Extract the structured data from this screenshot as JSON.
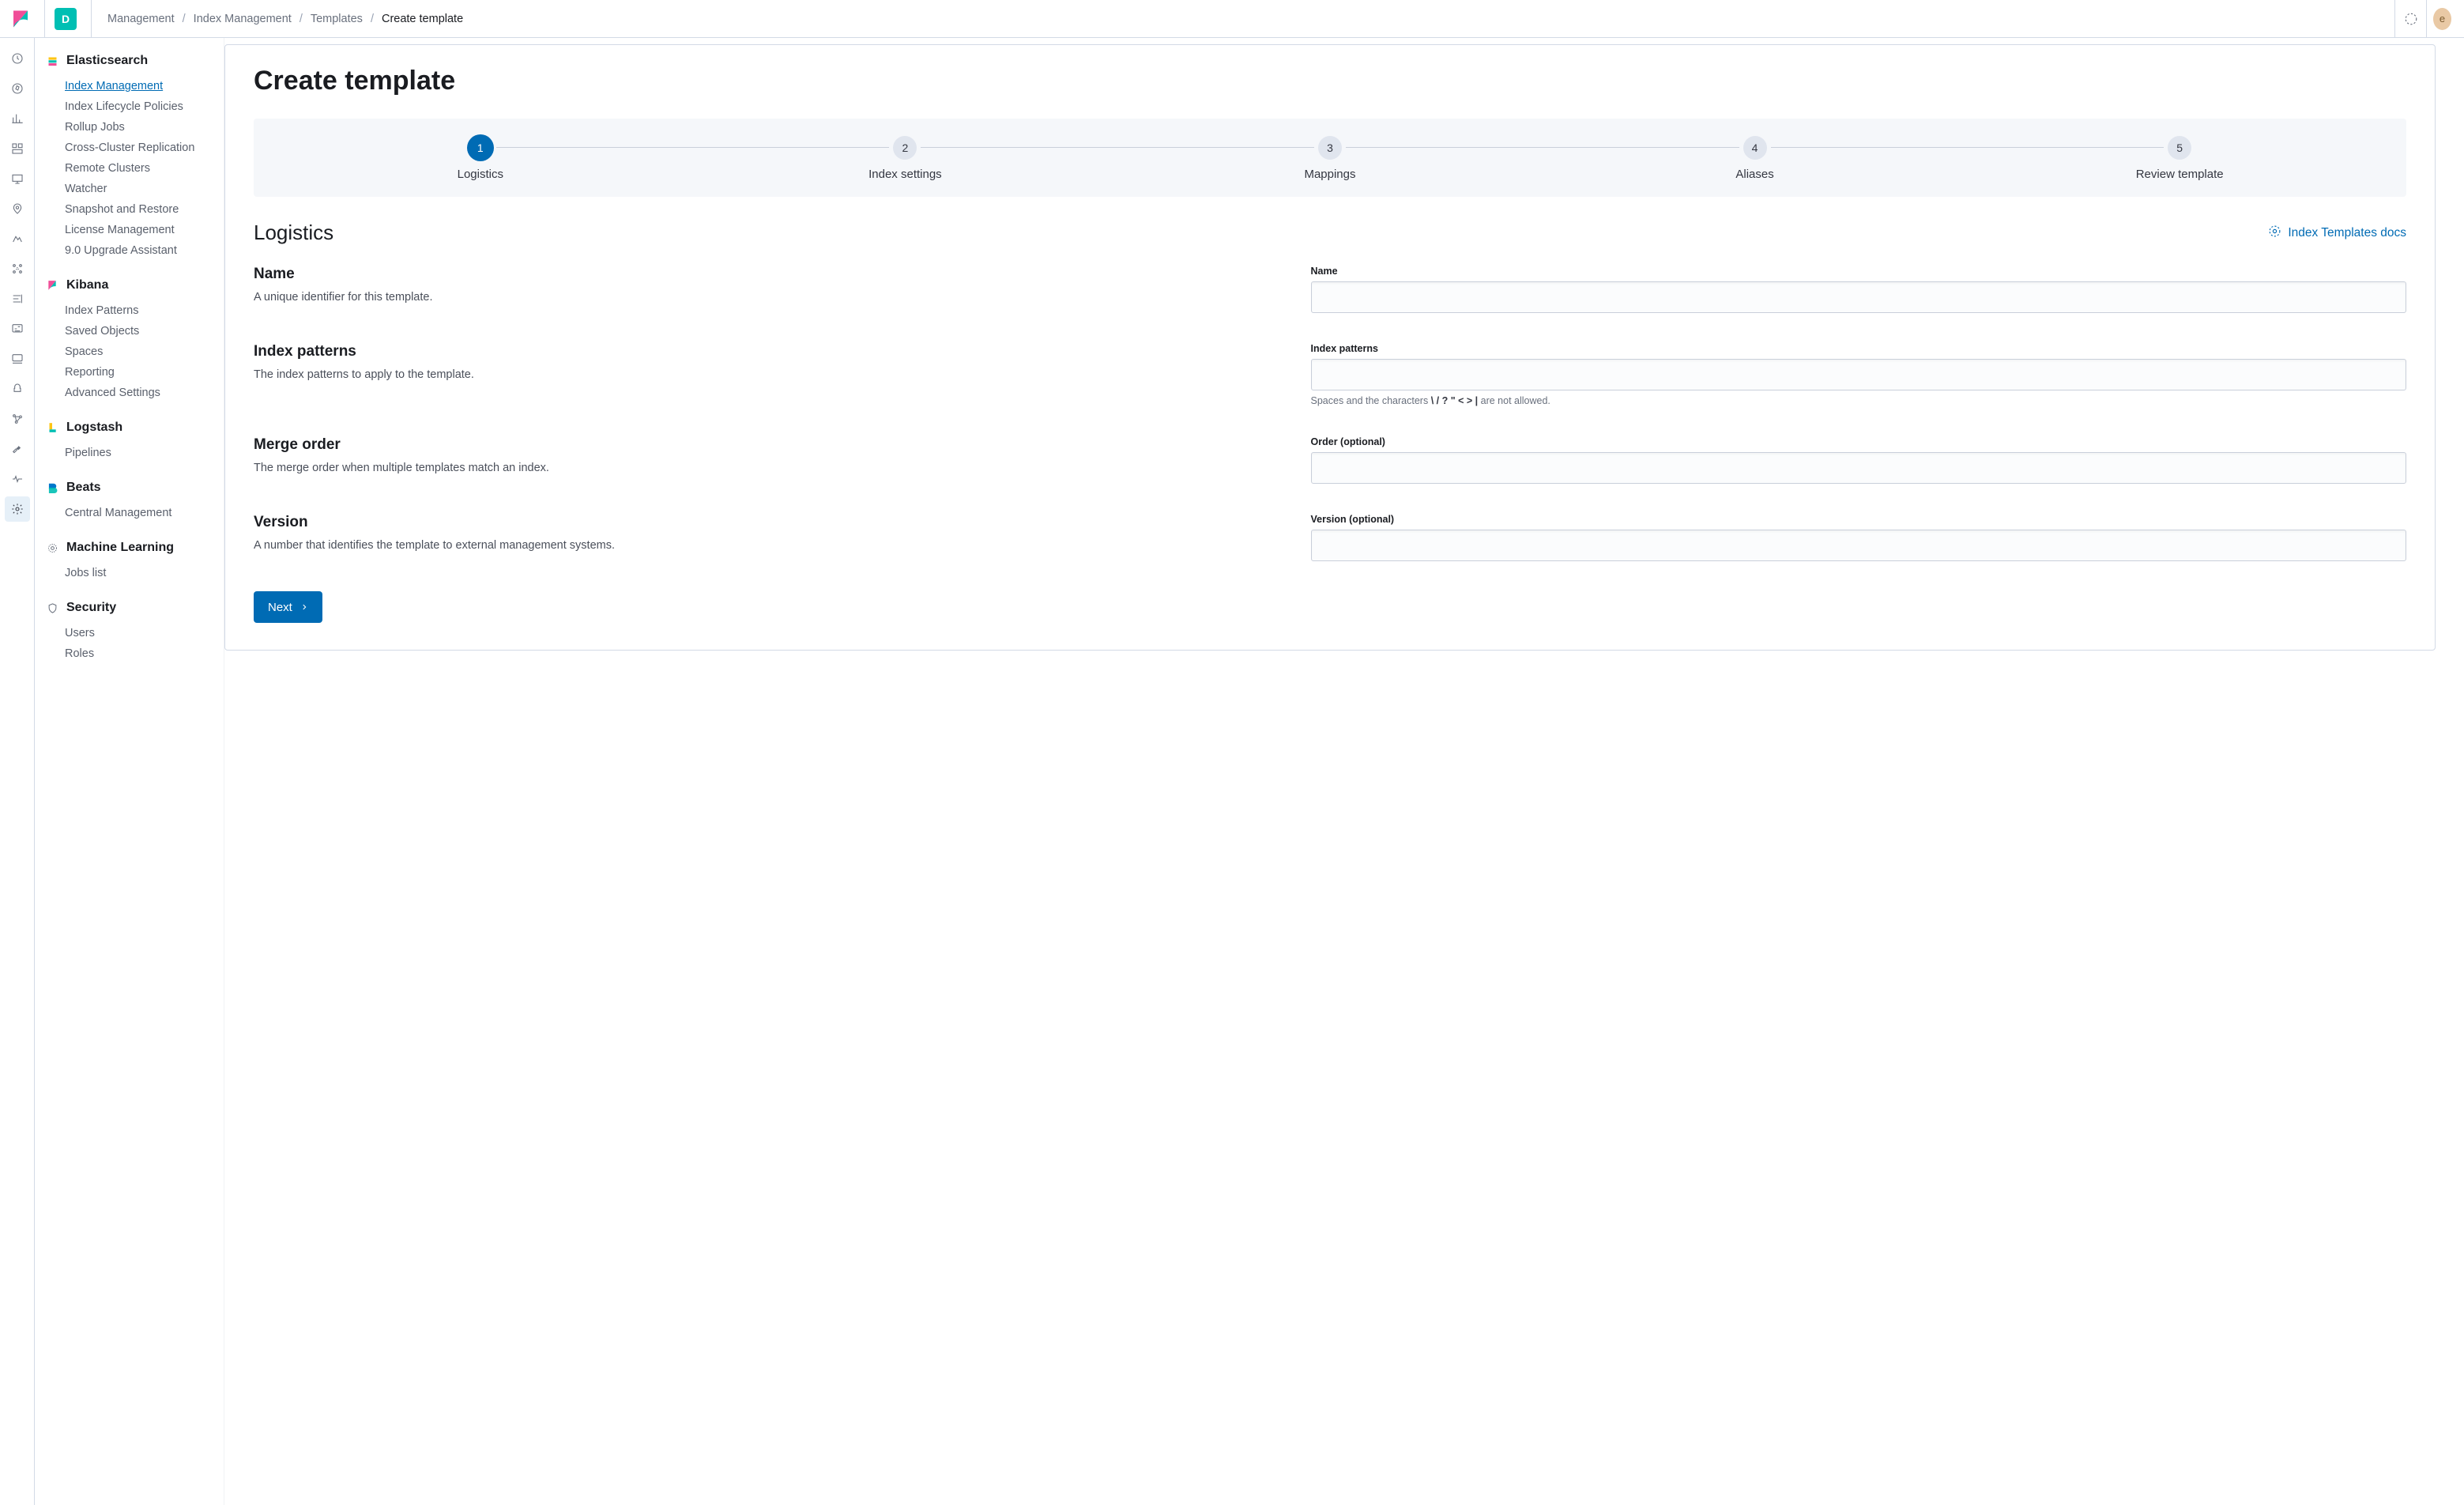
{
  "header": {
    "space_initial": "D",
    "avatar_initial": "e",
    "breadcrumbs": [
      "Management",
      "Index Management",
      "Templates",
      "Create template"
    ]
  },
  "sidebar": {
    "sections": [
      {
        "title": "Elasticsearch",
        "icon_color": "#00bfb3",
        "items": [
          "Index Management",
          "Index Lifecycle Policies",
          "Rollup Jobs",
          "Cross-Cluster Replication",
          "Remote Clusters",
          "Watcher",
          "Snapshot and Restore",
          "License Management",
          "9.0 Upgrade Assistant"
        ],
        "active_index": 0
      },
      {
        "title": "Kibana",
        "icon_color": "#f04e98",
        "items": [
          "Index Patterns",
          "Saved Objects",
          "Spaces",
          "Reporting",
          "Advanced Settings"
        ]
      },
      {
        "title": "Logstash",
        "icon_color": "#fec514",
        "items": [
          "Pipelines"
        ]
      },
      {
        "title": "Beats",
        "icon_color": "#0077cc",
        "items": [
          "Central Management"
        ]
      },
      {
        "title": "Machine Learning",
        "icon_color": "#017d73",
        "items": [
          "Jobs list"
        ]
      },
      {
        "title": "Security",
        "icon_color": "#69707d",
        "items": [
          "Users",
          "Roles"
        ]
      }
    ]
  },
  "rail_icons": [
    "clock-icon",
    "compass-icon",
    "bar-chart-icon",
    "dashboard-icon",
    "canvas-icon",
    "map-pin-icon",
    "ml-icon",
    "infra-icon",
    "logs-icon",
    "apm-icon",
    "uptime-icon",
    "siem-icon",
    "graph-icon",
    "dev-tools-icon",
    "monitor-icon",
    "management-gear-icon"
  ],
  "page": {
    "title": "Create template",
    "section_title": "Logistics",
    "docs_link_label": "Index Templates docs",
    "next_button": "Next",
    "steps": [
      {
        "num": "1",
        "label": "Logistics"
      },
      {
        "num": "2",
        "label": "Index settings"
      },
      {
        "num": "3",
        "label": "Mappings"
      },
      {
        "num": "4",
        "label": "Aliases"
      },
      {
        "num": "5",
        "label": "Review template"
      }
    ],
    "fields": {
      "name": {
        "title": "Name",
        "desc": "A unique identifier for this template.",
        "label": "Name"
      },
      "patterns": {
        "title": "Index patterns",
        "desc": "The index patterns to apply to the template.",
        "label": "Index patterns",
        "help_prefix": "Spaces and the characters ",
        "help_chars": "\\ / ? \" < > |",
        "help_suffix": " are not allowed."
      },
      "order": {
        "title": "Merge order",
        "desc": "The merge order when multiple templates match an index.",
        "label": "Order (optional)"
      },
      "version": {
        "title": "Version",
        "desc": "A number that identifies the template to external management systems.",
        "label": "Version (optional)"
      }
    }
  }
}
